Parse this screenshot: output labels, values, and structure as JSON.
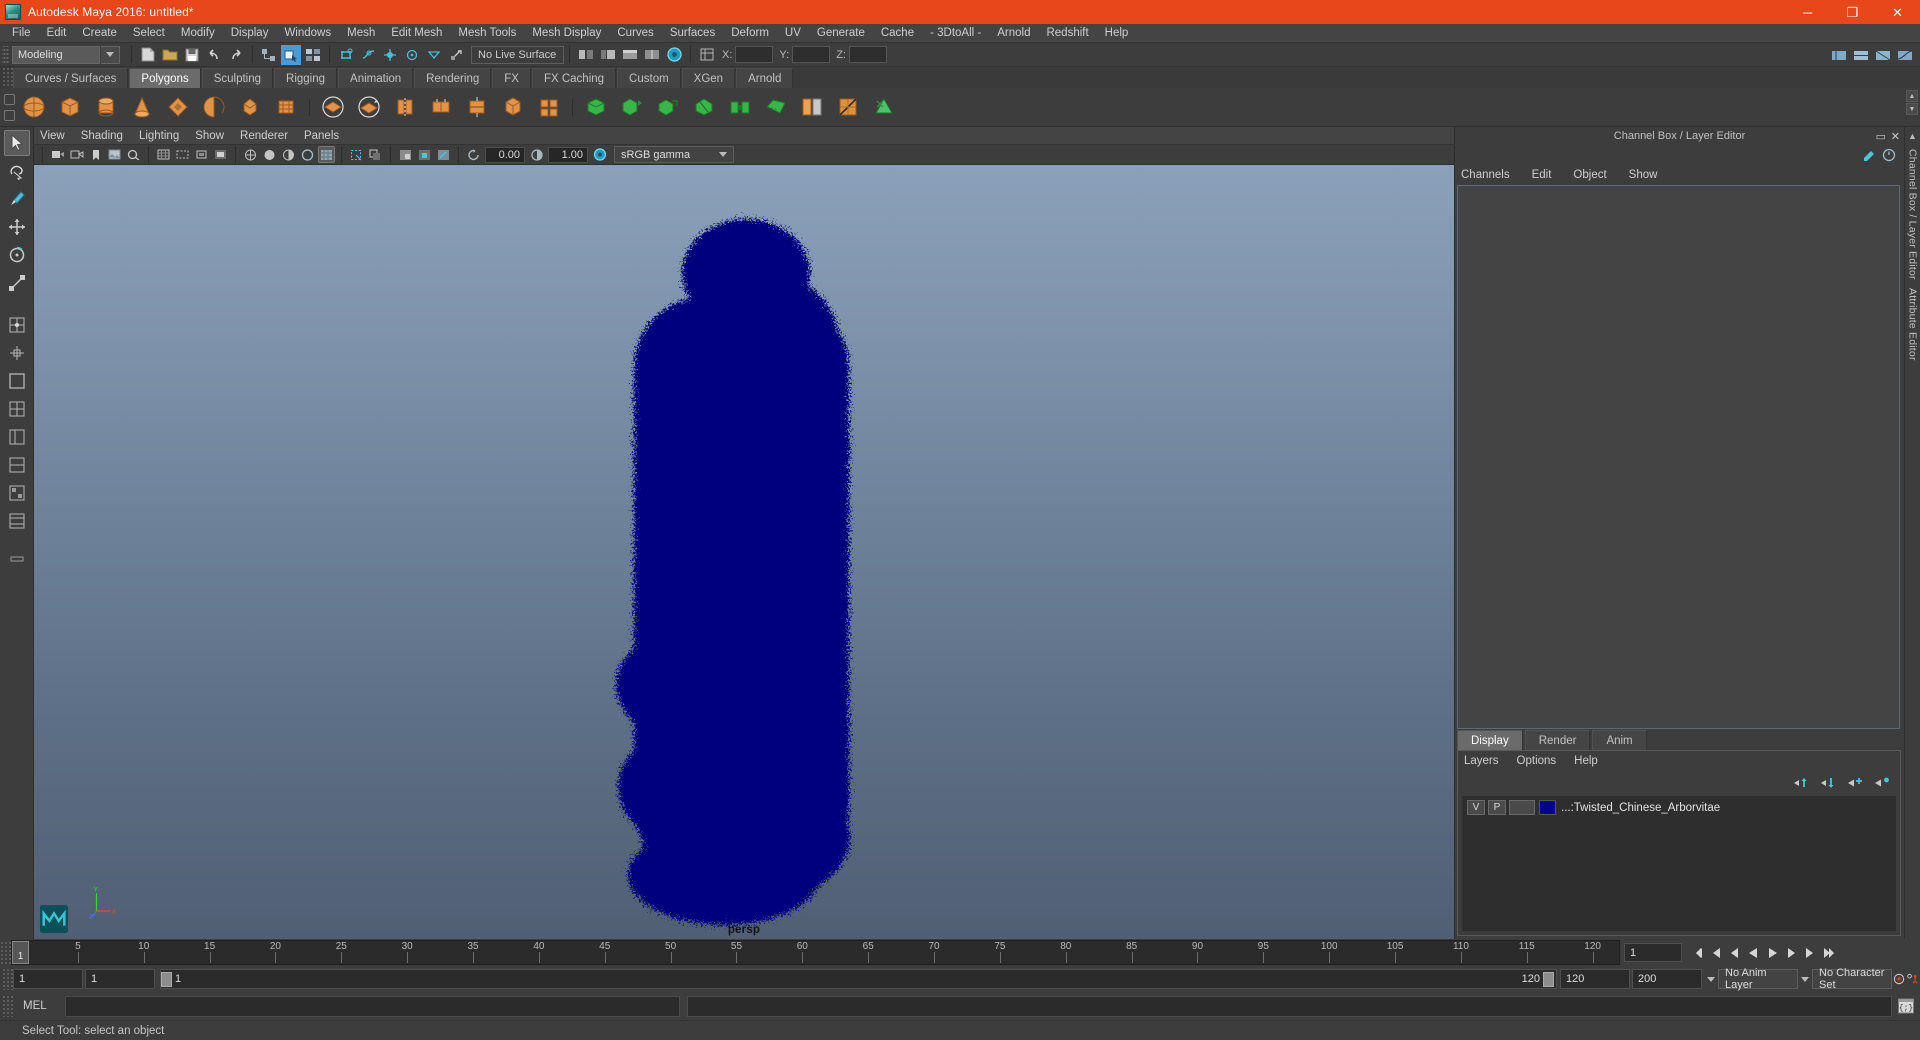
{
  "window": {
    "title": "Autodesk Maya 2016: untitled*",
    "app_icon": "maya-logo-icon",
    "controls": [
      {
        "name": "minimize-button",
        "glyph": "─"
      },
      {
        "name": "maximize-button",
        "glyph": "❐"
      },
      {
        "name": "close-button",
        "glyph": "✕"
      }
    ],
    "accent_color": "#e8471c",
    "chrome_color": "#3d3d3d"
  },
  "menubar": {
    "items": [
      "File",
      "Edit",
      "Create",
      "Select",
      "Modify",
      "Display",
      "Windows",
      "Mesh",
      "Edit Mesh",
      "Mesh Tools",
      "Mesh Display",
      "Curves",
      "Surfaces",
      "Deform",
      "UV",
      "Generate",
      "Cache",
      "- 3DtoAll -",
      "Arnold",
      "Redshift",
      "Help"
    ]
  },
  "statusline": {
    "menu_set": "Modeling",
    "live_surface": "No Live Surface",
    "coord_labels": [
      "X:",
      "Y:",
      "Z:"
    ],
    "coord_values": [
      "",
      "",
      ""
    ],
    "active_toggle": "snap-to-grid-toggle"
  },
  "shelf": {
    "tabs": [
      "Curves / Surfaces",
      "Polygons",
      "Sculpting",
      "Rigging",
      "Animation",
      "Rendering",
      "FX",
      "FX Caching",
      "Custom",
      "XGen",
      "Arnold"
    ],
    "active_tab": "Polygons",
    "icons": [
      "poly-sphere",
      "poly-cube",
      "poly-cylinder",
      "poly-cone",
      "poly-torus",
      "poly-plane",
      "poly-disc",
      "poly-pipe",
      "poly-prism",
      "poly-pyramid",
      "poly-helix",
      "poly-gear",
      "poly-soccer-ball",
      "poly-platonic",
      "combine",
      "separate",
      "extrude",
      "bevel",
      "bridge",
      "append-polygon",
      "smooth",
      "mirror",
      "boolean",
      "multi-cut",
      "target-weld",
      "quad-draw",
      "crease",
      "insert-edge-loop",
      "offset-edge-loop",
      "connect",
      "detach",
      "merge",
      "delete-edge"
    ]
  },
  "toolbox": {
    "tools": [
      "select-tool",
      "lasso-select-tool",
      "paint-select-tool",
      "move-tool",
      "rotate-tool",
      "scale-tool",
      "soft-modification-tool",
      "show-manipulator-tool",
      "last-tool-used"
    ]
  },
  "viewport": {
    "menus": [
      "View",
      "Shading",
      "Lighting",
      "Show",
      "Renderer",
      "Panels"
    ],
    "camera_label": "persp",
    "exposure_value": "0.00",
    "gamma_value": "1.00",
    "color_management": "sRGB gamma",
    "axis_labels": {
      "y": "Y",
      "x": "X",
      "z": "Z"
    },
    "background_top": "#8ba1b9",
    "background_bottom": "#515f73",
    "object_color": "#00007f",
    "object_name": "Twisted_Chinese_Arborvitae"
  },
  "right_panel": {
    "title": "Channel Box / Layer Editor",
    "channel_menu": [
      "Channels",
      "Edit",
      "Object",
      "Show"
    ],
    "minimize_glyph": "▭",
    "close_glyph": "✕",
    "layer_tabs": [
      "Display",
      "Render",
      "Anim"
    ],
    "layer_active_tab": "Display",
    "layer_menu": [
      "Layers",
      "Options",
      "Help"
    ],
    "layer_buttons": [
      "move-layer-up-icon",
      "move-layer-down-icon",
      "new-layer-icon",
      "new-layer-from-selected-icon"
    ],
    "layers": [
      {
        "visibility": "V",
        "playback": "P",
        "display_type": "",
        "color": "#00008f",
        "name": "...:Twisted_Chinese_Arborvitae"
      }
    ]
  },
  "dock_strip": {
    "labels": [
      "Channel Box / Layer Editor",
      "Attribute Editor"
    ]
  },
  "timeline": {
    "current_frame": "1",
    "current_frame_field": "1",
    "ticks": [
      5,
      10,
      15,
      20,
      25,
      30,
      35,
      40,
      45,
      50,
      55,
      60,
      65,
      70,
      75,
      80,
      85,
      90,
      95,
      100,
      105,
      110,
      115,
      120
    ],
    "range_start": "1",
    "range_end": "120",
    "playback_start": "1",
    "playback_end": "120",
    "anim_start": "120",
    "anim_end": "200",
    "slider_left_label": "1",
    "slider_right_label": "120",
    "anim_layer": "No Anim Layer",
    "character_set": "No Character Set",
    "playback_buttons": [
      "go-to-start-icon",
      "step-back-frame-icon",
      "step-back-key-icon",
      "play-backwards-icon",
      "play-forwards-icon",
      "step-forward-key-icon",
      "step-forward-frame-icon",
      "go-to-end-icon"
    ]
  },
  "command_line": {
    "label": "MEL",
    "input_value": "",
    "output_value": "",
    "script_editor_icon": "script-editor-icon"
  },
  "helpline": {
    "text": "Select Tool: select an object"
  }
}
